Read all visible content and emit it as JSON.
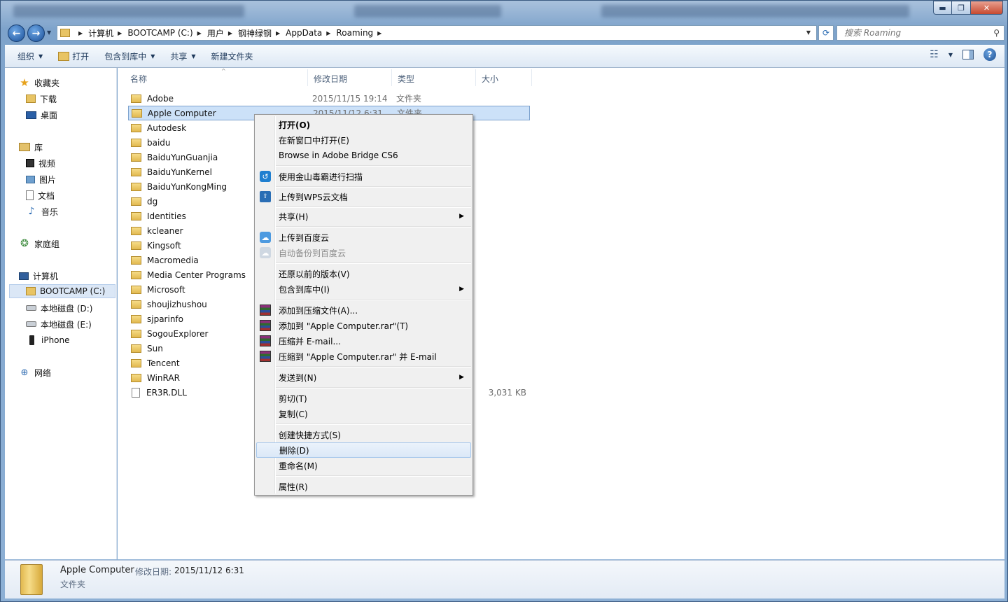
{
  "window": {
    "controls": {
      "minimize": "▬",
      "maximize": "❐",
      "close": "✕"
    }
  },
  "address_bar": {
    "breadcrumbs": [
      "计算机",
      "BOOTCAMP (C:)",
      "用户",
      "钢神绿钢",
      "AppData",
      "Roaming"
    ],
    "refresh_icon": "refresh-icon",
    "search_placeholder": "搜索 Roaming"
  },
  "command_bar": {
    "organize": "组织",
    "open": "打开",
    "include_in_library": "包含到库中",
    "share": "共享",
    "new_folder": "新建文件夹"
  },
  "nav_pane": {
    "favorites": "收藏夹",
    "downloads": "下载",
    "desktop": "桌面",
    "libraries": "库",
    "videos": "视频",
    "pictures": "图片",
    "documents": "文档",
    "music": "音乐",
    "homegroup": "家庭组",
    "computer": "计算机",
    "drive_c": "BOOTCAMP (C:)",
    "drive_d": "本地磁盘 (D:)",
    "drive_e": "本地磁盘 (E:)",
    "iphone": "iPhone",
    "network": "网络"
  },
  "columns": {
    "name": "名称",
    "date": "修改日期",
    "type": "类型",
    "size": "大小"
  },
  "files": [
    {
      "name": "Adobe",
      "date": "2015/11/15 19:14",
      "type": "文件夹",
      "size": ""
    },
    {
      "name": "Apple Computer",
      "date": "2015/11/12 6:31",
      "type": "文件夹",
      "size": ""
    },
    {
      "name": "Autodesk",
      "date": "",
      "type": "",
      "size": ""
    },
    {
      "name": "baidu",
      "date": "",
      "type": "",
      "size": ""
    },
    {
      "name": "BaiduYunGuanjia",
      "date": "",
      "type": "",
      "size": ""
    },
    {
      "name": "BaiduYunKernel",
      "date": "",
      "type": "",
      "size": ""
    },
    {
      "name": "BaiduYunKongMing",
      "date": "",
      "type": "",
      "size": ""
    },
    {
      "name": "dg",
      "date": "",
      "type": "",
      "size": ""
    },
    {
      "name": "Identities",
      "date": "",
      "type": "",
      "size": ""
    },
    {
      "name": "kcleaner",
      "date": "",
      "type": "",
      "size": ""
    },
    {
      "name": "Kingsoft",
      "date": "",
      "type": "",
      "size": ""
    },
    {
      "name": "Macromedia",
      "date": "",
      "type": "",
      "size": ""
    },
    {
      "name": "Media Center Programs",
      "date": "",
      "type": "",
      "size": ""
    },
    {
      "name": "Microsoft",
      "date": "",
      "type": "",
      "size": ""
    },
    {
      "name": "shoujizhushou",
      "date": "",
      "type": "",
      "size": ""
    },
    {
      "name": "sjparinfo",
      "date": "",
      "type": "",
      "size": ""
    },
    {
      "name": "SogouExplorer",
      "date": "",
      "type": "",
      "size": ""
    },
    {
      "name": "Sun",
      "date": "",
      "type": "",
      "size": ""
    },
    {
      "name": "Tencent",
      "date": "",
      "type": "",
      "size": ""
    },
    {
      "name": "WinRAR",
      "date": "",
      "type": "",
      "size": ""
    },
    {
      "name": "ER3R.DLL",
      "date": "",
      "type": "",
      "size": "3,031 KB"
    }
  ],
  "context_menu": {
    "open": "打开(O)",
    "open_new_window": "在新窗口中打开(E)",
    "browse_bridge": "Browse in Adobe Bridge CS6",
    "jinshan_scan": "使用金山毒霸进行扫描",
    "wps_upload": "上传到WPS云文档",
    "share": "共享(H)",
    "baidu_upload": "上传到百度云",
    "baidu_backup": "自动备份到百度云",
    "restore_versions": "还原以前的版本(V)",
    "include_library": "包含到库中(I)",
    "add_archive": "添加到压缩文件(A)...",
    "add_to_rar": "添加到 \"Apple Computer.rar\"(T)",
    "compress_email": "压缩并 E-mail...",
    "compress_rar_email": "压缩到 \"Apple Computer.rar\" 并 E-mail",
    "send_to": "发送到(N)",
    "cut": "剪切(T)",
    "copy": "复制(C)",
    "create_shortcut": "创建快捷方式(S)",
    "delete": "删除(D)",
    "rename": "重命名(M)",
    "properties": "属性(R)"
  },
  "details": {
    "name": "Apple Computer",
    "date_label": "修改日期:",
    "date": "2015/11/12 6:31",
    "type": "文件夹"
  }
}
